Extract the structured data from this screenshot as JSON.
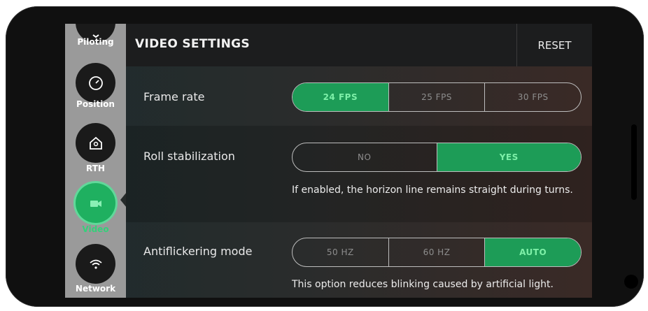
{
  "header": {
    "title": "VIDEO SETTINGS",
    "reset_label": "RESET"
  },
  "nav": {
    "items": [
      {
        "label": "Piloting",
        "icon": "chevron-down-icon"
      },
      {
        "label": "Position",
        "icon": "compass-icon"
      },
      {
        "label": "RTH",
        "icon": "home-icon"
      },
      {
        "label": "Video",
        "icon": "video-camera-icon",
        "active": true
      },
      {
        "label": "Network",
        "icon": "wifi-icon"
      }
    ]
  },
  "settings": {
    "frame_rate": {
      "label": "Frame rate",
      "options": [
        "24 FPS",
        "25 FPS",
        "30 FPS"
      ],
      "selected": "24 FPS"
    },
    "roll_stabilization": {
      "label": "Roll stabilization",
      "options": [
        "NO",
        "YES"
      ],
      "selected": "YES",
      "help": "If enabled, the horizon line remains straight during turns."
    },
    "antiflickering": {
      "label": "Antiflickering mode",
      "options": [
        "50 HZ",
        "60 HZ",
        "AUTO"
      ],
      "selected": "AUTO",
      "help": "This option reduces blinking caused by artificial light."
    }
  },
  "colors": {
    "accent": "#1d9c57",
    "accent_text": "#7ef0a8",
    "active_label": "#35d07a"
  }
}
